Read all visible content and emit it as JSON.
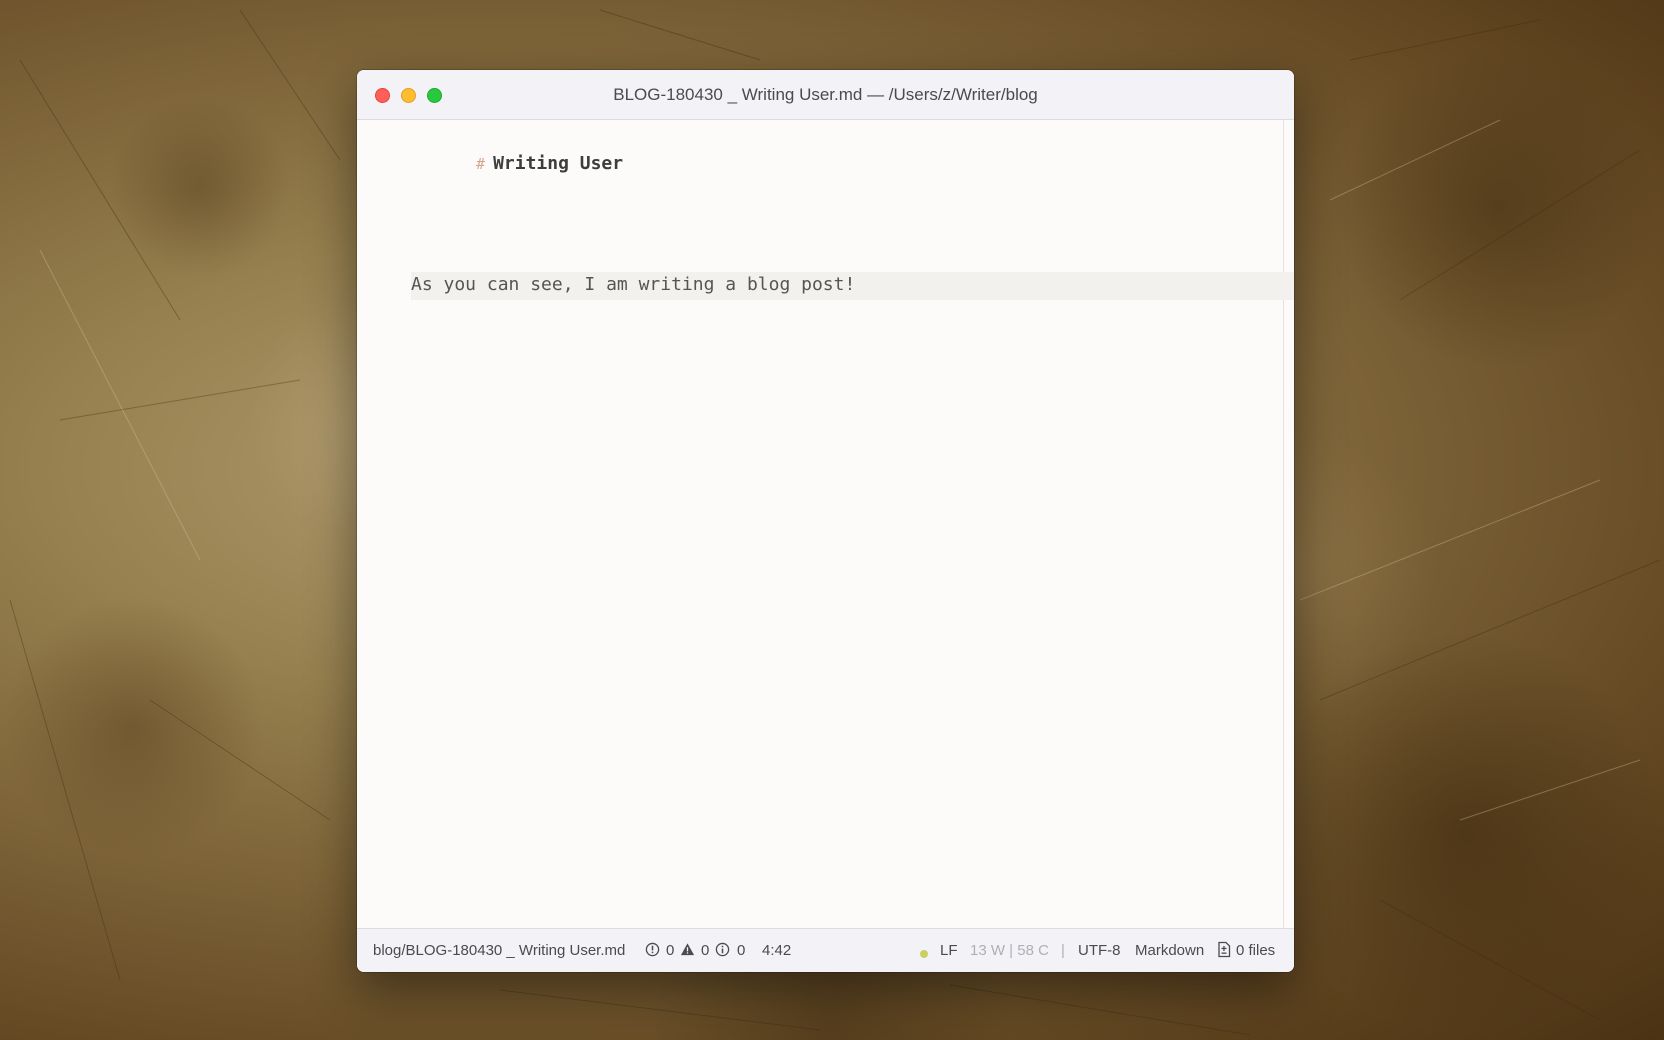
{
  "window": {
    "title": "BLOG-180430 _ Writing User.md — /Users/z/Writer/blog"
  },
  "editor": {
    "heading_marker": "#",
    "heading_text": "Writing User",
    "body_line": "As you can see, I am writing a blog post!"
  },
  "status_bar": {
    "file_path": "blog/BLOG-180430 _ Writing User.md",
    "errors_count": "0",
    "warnings_count": "0",
    "infos_count": "0",
    "cursor_position": "4:42",
    "line_ending": "LF",
    "word_char_count": "13 W | 58 C",
    "separator": "|",
    "encoding": "UTF-8",
    "grammar": "Markdown",
    "files_label": "0 files"
  },
  "colors": {
    "close": "#ff5f57",
    "minimize": "#febc2e",
    "zoom": "#28c840",
    "git_status_dot": "#c9cf63",
    "heading_marker": "#d6a58f"
  },
  "icons": {
    "errors": "exclamation-circle-icon",
    "warnings": "warning-triangle-icon",
    "infos": "info-circle-icon",
    "files": "file-diff-icon"
  }
}
